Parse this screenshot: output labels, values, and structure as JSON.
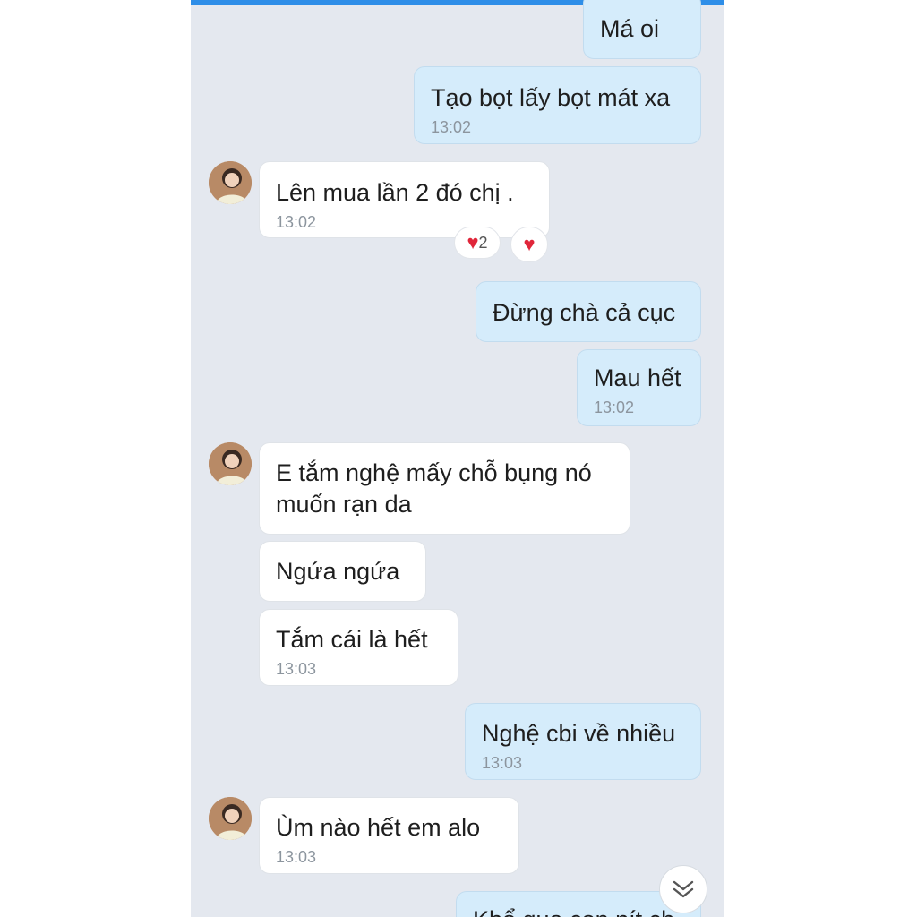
{
  "messages": [
    {
      "text": "Má oi",
      "time": ""
    },
    {
      "text": "Tạo bọt lấy bọt mát xa",
      "time": "13:02"
    },
    {
      "text": "Lên mua lần 2 đó chị .",
      "time": "13:02"
    },
    {
      "text": "Đừng chà cả cục",
      "time": ""
    },
    {
      "text": "Mau hết",
      "time": "13:02"
    },
    {
      "text": "E tắm nghệ mấy chỗ bụng nó\nmuốn rạn da",
      "time": ""
    },
    {
      "text": "Ngứa ngứa",
      "time": ""
    },
    {
      "text": "Tắm cái là hết",
      "time": "13:03"
    },
    {
      "text": "Nghệ cbi về nhiều",
      "time": "13:03"
    },
    {
      "text": "Ùm nào hết em alo",
      "time": "13:03"
    },
    {
      "text": "Khổ qua con nít ch",
      "time": ""
    }
  ],
  "reactions": {
    "summary_count": "2",
    "summary_icon": "heart-icon",
    "add_icon": "heart-icon",
    "heart_color": "#e0263a"
  },
  "colors": {
    "outgoing_bubble": "#d5ecfb",
    "incoming_bubble": "#ffffff",
    "background": "#e4e8ef",
    "accent": "#2e8ee8"
  },
  "icons": {
    "scroll_down": "double-chevron-down-icon",
    "avatar": "contact-avatar"
  }
}
